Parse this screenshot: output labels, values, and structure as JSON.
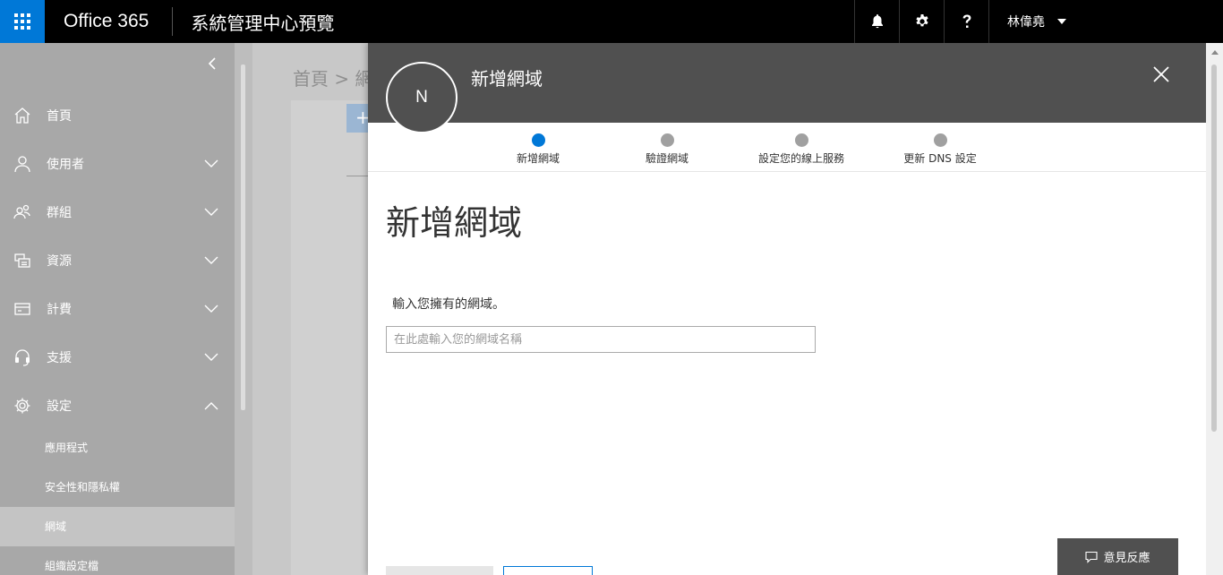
{
  "topbar": {
    "brand": "Office 365",
    "app_title": "系統管理中心預覽",
    "user_name": "林偉堯"
  },
  "sidebar": {
    "items": [
      {
        "label": "首頁",
        "icon": "home-icon"
      },
      {
        "label": "使用者",
        "icon": "user-icon"
      },
      {
        "label": "群組",
        "icon": "group-icon"
      },
      {
        "label": "資源",
        "icon": "resources-icon"
      },
      {
        "label": "計費",
        "icon": "billing-icon"
      },
      {
        "label": "支援",
        "icon": "headset-icon"
      },
      {
        "label": "設定",
        "icon": "gear-icon"
      }
    ],
    "settings_sub": [
      {
        "label": "應用程式"
      },
      {
        "label": "安全性和隱私權"
      },
      {
        "label": "網域"
      },
      {
        "label": "組織設定檔"
      }
    ]
  },
  "background": {
    "breadcrumb": "首頁 > 網域",
    "add_button": "+"
  },
  "panel": {
    "avatar_letter": "N",
    "header_title": "新增網域",
    "steps": [
      {
        "label": "新增網域",
        "active": true
      },
      {
        "label": "驗證網域",
        "active": false
      },
      {
        "label": "設定您的線上服務",
        "active": false
      },
      {
        "label": "更新 DNS 設定",
        "active": false
      }
    ],
    "page_title": "新增網域",
    "prompt": "輸入您擁有的網域。",
    "input_placeholder": "在此處輸入您的網域名稱",
    "input_value": ""
  },
  "feedback": {
    "label": "意見反應"
  },
  "colors": {
    "accent": "#0078d7",
    "topbar": "#000000",
    "panel_header": "#505050",
    "sidebar": "#a8a8a8"
  }
}
